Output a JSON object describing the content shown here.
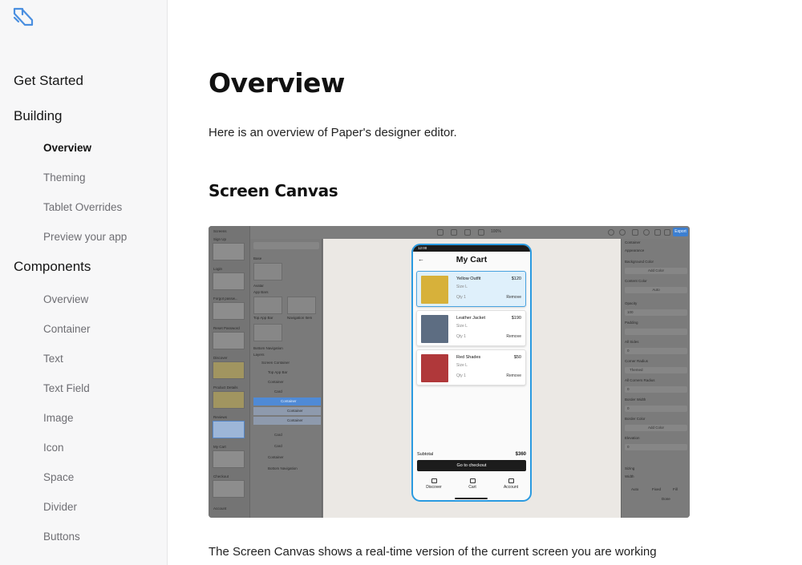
{
  "sidebar": {
    "logo": "paper-logo",
    "sections": [
      {
        "label": "Get Started",
        "items": []
      },
      {
        "label": "Building",
        "items": [
          {
            "label": "Overview",
            "active": true
          },
          {
            "label": "Theming"
          },
          {
            "label": "Tablet Overrides"
          },
          {
            "label": "Preview your app"
          }
        ]
      },
      {
        "label": "Components",
        "items": [
          {
            "label": "Overview"
          },
          {
            "label": "Container"
          },
          {
            "label": "Text"
          },
          {
            "label": "Text Field"
          },
          {
            "label": "Image"
          },
          {
            "label": "Icon"
          },
          {
            "label": "Space"
          },
          {
            "label": "Divider"
          },
          {
            "label": "Buttons"
          }
        ]
      }
    ]
  },
  "content": {
    "title": "Overview",
    "intro": "Here is an overview of Paper's designer editor.",
    "section_heading": "Screen Canvas",
    "body_text": "The Screen Canvas shows a real-time version of the current screen you are working"
  },
  "screenshot": {
    "zoom": "100%",
    "export_label": "Export",
    "screens": [
      "Screens",
      "Sign Up",
      "Login",
      "Forgot passw...",
      "Reset Password",
      "Discover",
      "Product Details",
      "Reviews",
      "My Cart",
      "Checkout",
      "Account"
    ],
    "left_labels": [
      "Base",
      "Avatar",
      "App Bars",
      "Top App Bar",
      "Navigation Item",
      "Bottom Navigation",
      "Layers"
    ],
    "layers": [
      "Screen Container",
      "Top App Bar",
      "Container",
      "Card",
      "Container",
      "Container",
      "Container",
      "Card",
      "Card",
      "Container",
      "Bottom Navigation"
    ],
    "right_labels": [
      "Container",
      "Appearance",
      "Background Color",
      "Add Color",
      "Content Color",
      "Auto",
      "Opacity",
      "100",
      "Padding",
      "All Sides",
      "0",
      "Corner Radius",
      "Themed",
      "All Corners Radius",
      "0",
      "Border Width",
      "0",
      "Border Color",
      "Add Color",
      "Elevation",
      "0",
      "Sizing",
      "Width",
      "Auto",
      "Fixed",
      "Fill",
      "Done"
    ],
    "phone": {
      "status_time": "12:00",
      "title": "My Cart",
      "items": [
        {
          "name": "Yellow Outfit",
          "size": "Size L",
          "qty": "Qty 1",
          "price": "$120",
          "remove": "Remove",
          "image_color": "#d7b13a"
        },
        {
          "name": "Leather Jacket",
          "size": "Size L",
          "qty": "Qty 1",
          "price": "$190",
          "remove": "Remove",
          "image_color": "#5d6d82"
        },
        {
          "name": "Red Shades",
          "size": "Size L",
          "qty": "Qty 1",
          "price": "$50",
          "remove": "Remove",
          "image_color": "#b0383a"
        }
      ],
      "subtotal_label": "Subtotal",
      "subtotal_value": "$360",
      "checkout_label": "Go to checkout",
      "tabs": [
        "Discover",
        "Cart",
        "Account"
      ]
    }
  },
  "colors": {
    "accent": "#2a9ae0",
    "selection": "#4f8ad6",
    "sidebar_bg": "#f7f7f8"
  }
}
